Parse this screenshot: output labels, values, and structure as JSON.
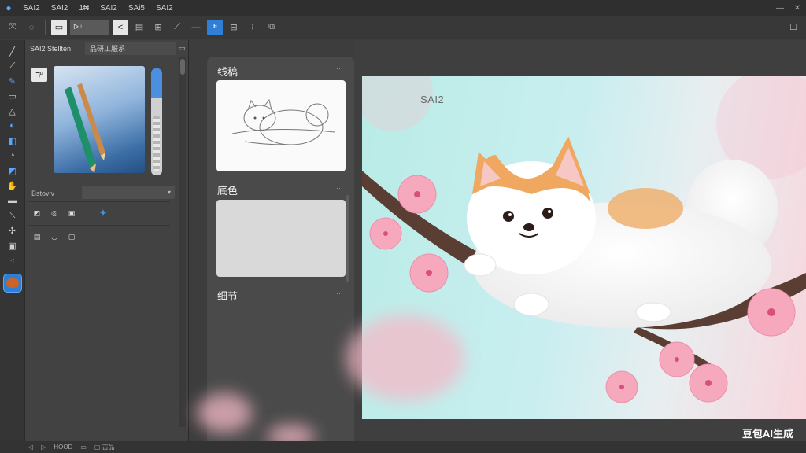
{
  "menubar": {
    "items": [
      "SAI2",
      "SAI2",
      "1₦",
      "SAI2",
      "SAi5",
      "SAI2"
    ],
    "window_buttons": [
      "—",
      "✕"
    ]
  },
  "toolbar": {
    "field_value": "ᐅ  ᵎ",
    "buttons": [
      "⤧",
      "◌",
      "▭",
      "<",
      "▤",
      "⊞",
      "⟋",
      "—",
      "ᴵᴱ",
      "⊟",
      "⁝",
      "⧉"
    ],
    "right_icon": "☐"
  },
  "brush_panel": {
    "title": "SAI2 Stellten",
    "tab": "品研工服系",
    "header_icon": "▭",
    "preview_icon_label": "ℸᴾ",
    "mode_label": "Bstoviv",
    "mode_dropdown": "▾"
  },
  "layers": {
    "items": [
      {
        "name": "线稿"
      },
      {
        "name": "底色"
      },
      {
        "name": "细节"
      }
    ],
    "more": "···"
  },
  "canvas": {
    "label": "SAI2",
    "watermark": "豆包AI生成"
  },
  "statusbar": {
    "items": [
      "◁",
      "▷",
      "HOOD",
      "▭",
      "▢ 古品"
    ]
  },
  "colors": {
    "accent": "#2f7fd6",
    "panel_bg": "#424242",
    "canvas_bg": "#c9eef0"
  }
}
